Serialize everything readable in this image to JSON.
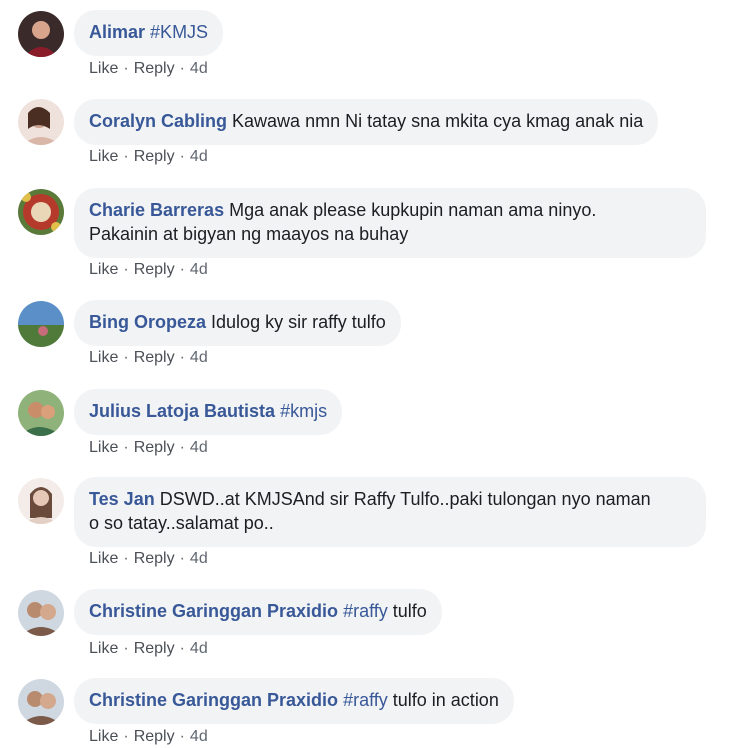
{
  "actions": {
    "like": "Like",
    "reply": "Reply",
    "separator": "·"
  },
  "comments": [
    {
      "author": "Alimar",
      "text_pre": "",
      "hashtag": "#KMJS",
      "text_post": "",
      "time": "4d",
      "avatar_color": "#8a1c2a"
    },
    {
      "author": "Coralyn Cabling",
      "text_pre": "Kawawa nmn Ni tatay sna mkita cya kmag anak nia",
      "hashtag": "",
      "text_post": "",
      "time": "4d",
      "avatar_color": "#c9a08e"
    },
    {
      "author": "Charie Barreras",
      "text_pre": "Mga anak please kupkupin naman ama ninyo.",
      "text_line2": "Pakainin at bigyan ng maayos na buhay",
      "hashtag": "",
      "text_post": "",
      "time": "4d",
      "avatar_color": "#b53a2c"
    },
    {
      "author": "Bing Oropeza",
      "text_pre": "Idulog ky sir raffy tulfo",
      "hashtag": "",
      "text_post": "",
      "time": "4d",
      "avatar_color": "#5a8fc7"
    },
    {
      "author": "Julius Latoja Bautista",
      "text_pre": "",
      "hashtag": "#kmjs",
      "text_post": "",
      "time": "4d",
      "avatar_color": "#3b6f4a"
    },
    {
      "author": "Tes Jan",
      "text_pre": "DSWD..at KMJSAnd sir Raffy Tulfo..paki tulongan nyo naman",
      "text_line2": "o so tatay..salamat po..",
      "hashtag": "",
      "text_post": "",
      "time": "4d",
      "avatar_color": "#e3cfc4"
    },
    {
      "author": "Christine Garinggan Praxidio",
      "text_pre": "",
      "hashtag": "#raffy",
      "text_post": " tulfo",
      "time": "4d",
      "avatar_color": "#7b5a4a"
    },
    {
      "author": "Christine Garinggan Praxidio",
      "text_pre": "",
      "hashtag": "#raffy",
      "text_post": " tulfo in action",
      "time": "4d",
      "avatar_color": "#7b5a4a"
    }
  ]
}
